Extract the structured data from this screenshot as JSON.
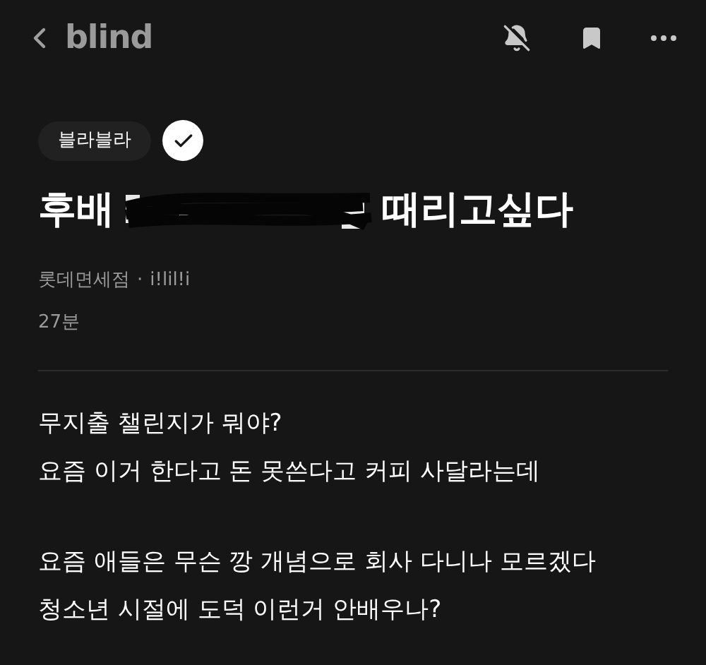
{
  "header": {
    "logo": "blind"
  },
  "post": {
    "tag": "블라블라",
    "title_start": "후배",
    "title_end": "때리고싶다",
    "company": "롯데면세점",
    "separator": "·",
    "nickname": "i!lil!i",
    "time": "27분",
    "paragraphs": [
      [
        "무지출 챌린지가 뭐야?",
        "요즘 이거 한다고 돈 못쓴다고 커피 사달라는데"
      ],
      [
        "요즘 애들은 무슨 깡 개념으로 회사 다니나 모르겠다",
        "청소년 시절에 도덕 이런거 안배우나?"
      ]
    ]
  }
}
